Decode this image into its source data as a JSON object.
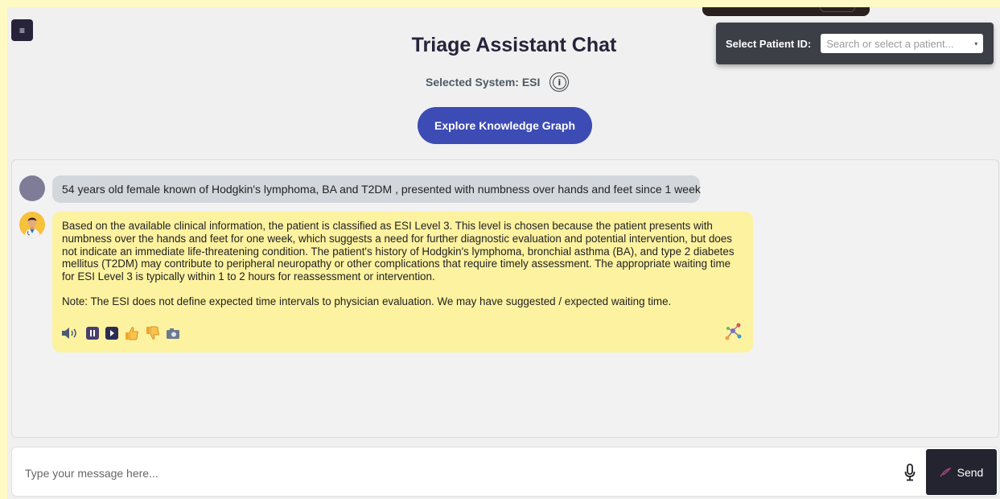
{
  "header": {
    "menu_icon": "≡",
    "title": "Triage Assistant Chat",
    "selected_system_label": "Selected System: ESI",
    "info_icon_glyph": "i",
    "kg_button_label": "Explore Knowledge Graph"
  },
  "patient": {
    "label": "Select Patient ID:",
    "placeholder": "Search or select a patient...",
    "arrow": "▾"
  },
  "chat": {
    "user_message": "54 years old female known of Hodgkin's lymphoma, BA and T2DM , presented with numbness over hands and feet since 1 week",
    "bot_message": "Based on the available clinical information, the patient is classified as ESI Level 3. This level is chosen because the patient presents with numbness over the hands and feet for one week, which suggests a need for further diagnostic evaluation and potential intervention, but does not indicate an immediate life-threatening condition. The patient's history of Hodgkin's lymphoma, bronchial asthma (BA), and type 2 diabetes mellitus (T2DM) may contribute to peripheral neuropathy or other complications that require timely assessment. The appropriate waiting time for ESI Level 3 is typically within 1 to 2 hours for reassessment or intervention.",
    "bot_note": "Note: The ESI does not define expected time intervals to physician evaluation. We may have suggested / expected waiting time.",
    "actions": [
      "speaker-icon",
      "pause-icon",
      "play-icon",
      "thumbs-up-icon",
      "thumbs-down-icon",
      "camera-icon"
    ]
  },
  "composer": {
    "placeholder": "Type your message here...",
    "send_label": "Send"
  },
  "colors": {
    "accent": "#3d4bb5",
    "bot_bubble": "#fdf2a0",
    "user_bubble": "#d2d7dc",
    "dark": "#26233a"
  }
}
